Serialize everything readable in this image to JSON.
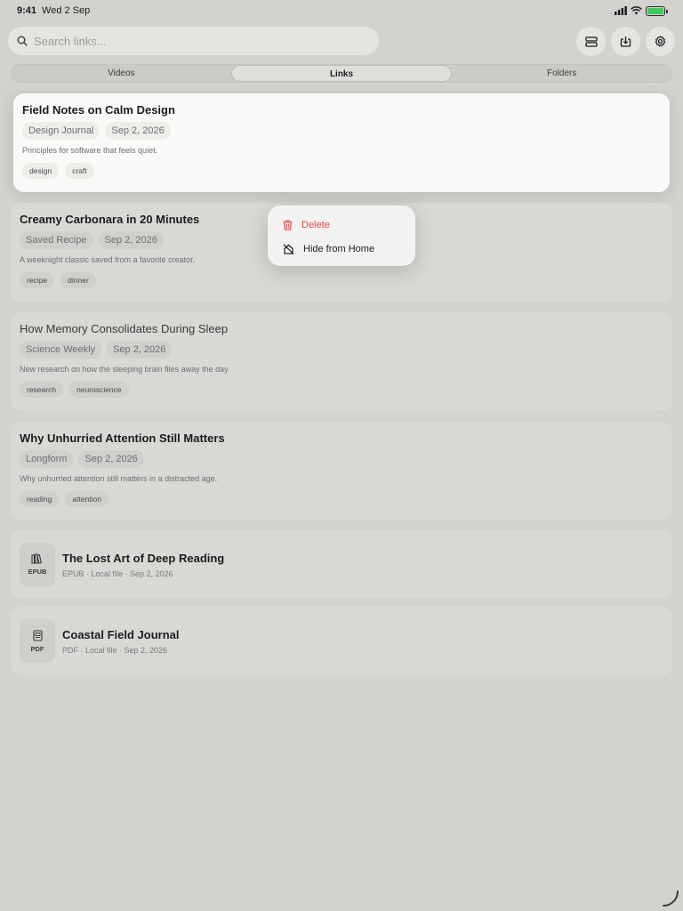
{
  "status_bar": {
    "time": "9:41",
    "date": "Wed 2 Sep"
  },
  "search": {
    "placeholder": "Search links..."
  },
  "header_buttons": [
    "layout-rows-icon",
    "import-icon",
    "gear-icon"
  ],
  "tabs": [
    {
      "label": "Videos",
      "active": false
    },
    {
      "label": "Links",
      "active": true
    },
    {
      "label": "Folders",
      "active": false
    }
  ],
  "links": [
    {
      "title": "Field Notes on Calm Design",
      "source": "Design Journal",
      "date": "Sep 2, 2026",
      "description": "Principles for software that feels quiet.",
      "tags": [
        "design",
        "craft"
      ]
    },
    {
      "title": "Creamy Carbonara in 20 Minutes",
      "source": "Saved Recipe",
      "date": "Sep 2, 2026",
      "description": "A weeknight classic saved from a favorite creator.",
      "tags": [
        "recipe",
        "dinner"
      ]
    },
    {
      "title": "How Memory Consolidates During Sleep",
      "source": "Science Weekly",
      "date": "Sep 2, 2026",
      "description": "New research on how the sleeping brain files away the day.",
      "tags": [
        "research",
        "neuroscience"
      ]
    },
    {
      "title": "Why Unhurried Attention Still Matters",
      "source": "Longform",
      "date": "Sep 2, 2026",
      "description": "Why unhurried attention still matters in a distracted age.",
      "tags": [
        "reading",
        "attention"
      ]
    }
  ],
  "files": [
    {
      "badge": "EPUB",
      "title": "The Lost Art of Deep Reading",
      "subtitle": "EPUB · Local file · Sep 2, 2026"
    },
    {
      "badge": "PDF",
      "title": "Coastal Field Journal",
      "subtitle": "PDF · Local file · Sep 2, 2026"
    }
  ],
  "context_menu": {
    "delete_label": "Delete",
    "hide_label": "Hide from Home",
    "delete_color": "#e5484d"
  },
  "colors": {
    "battery": "#34c759",
    "accent_danger": "#e5484d"
  }
}
